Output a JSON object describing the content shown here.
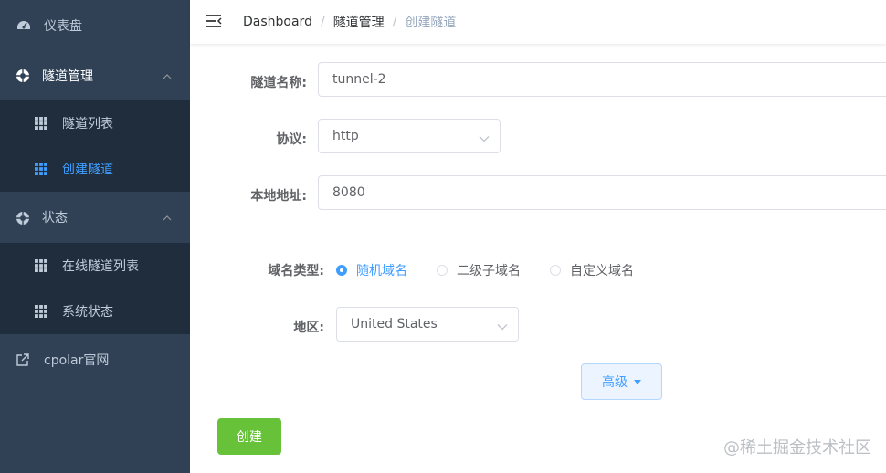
{
  "sidebar": {
    "items": [
      {
        "label": "仪表盘",
        "icon": "dashboard-icon"
      },
      {
        "label": "隧道管理",
        "icon": "lifebuoy-icon",
        "expanded": true
      },
      {
        "label": "隧道列表",
        "icon": "grid-icon"
      },
      {
        "label": "创建隧道",
        "icon": "grid-icon",
        "active": true
      },
      {
        "label": "状态",
        "icon": "lifebuoy-icon",
        "expanded": true
      },
      {
        "label": "在线隧道列表",
        "icon": "grid-icon"
      },
      {
        "label": "系统状态",
        "icon": "grid-icon"
      },
      {
        "label": "cpolar官网",
        "icon": "external-link-icon"
      }
    ]
  },
  "header": {
    "breadcrumb": [
      "Dashboard",
      "隧道管理",
      "创建隧道"
    ],
    "separator": "/"
  },
  "form": {
    "name_label": "隧道名称:",
    "name_value": "tunnel-2",
    "protocol_label": "协议:",
    "protocol_value": "http",
    "local_addr_label": "本地地址:",
    "local_addr_value": "8080",
    "domain_type_label": "域名类型:",
    "domain_type_options": [
      "随机域名",
      "二级子域名",
      "自定义域名"
    ],
    "domain_type_selected": "随机域名",
    "region_label": "地区:",
    "region_value": "United States",
    "advanced_button": "高级",
    "create_button": "创建"
  },
  "watermark": "@稀土掘金技术社区",
  "colors": {
    "sidebar_bg": "#304156",
    "submenu_bg": "#1f2d3d",
    "primary": "#409eff",
    "success": "#67c23a"
  }
}
